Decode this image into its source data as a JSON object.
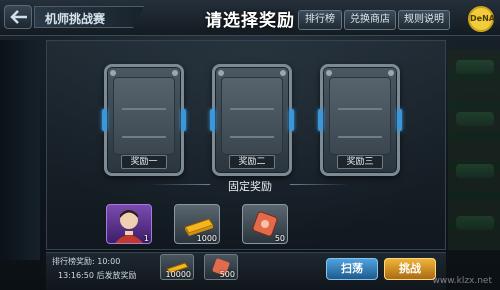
{
  "topbar": {
    "mode_title": "机师挑战赛",
    "title": "请选择奖励",
    "buttons": [
      "排行榜",
      "兑换商店",
      "规则说明"
    ],
    "logo_text": "DeNA"
  },
  "cards": [
    {
      "label": "奖励一"
    },
    {
      "label": "奖励二"
    },
    {
      "label": "奖励三"
    }
  ],
  "fixed_reward": {
    "title": "固定奖励",
    "items": [
      {
        "icon": "pilot-portrait-icon",
        "count": "1"
      },
      {
        "icon": "gold-bar-icon",
        "count": "1000"
      },
      {
        "icon": "ticket-icon",
        "count": "50"
      }
    ]
  },
  "bottom": {
    "rank_reward_label": "排行榜奖励: 10:00",
    "timer_text": "13:16:50 后发放奖励",
    "mini_items": [
      {
        "icon": "gold-bar-icon",
        "count": "10000"
      },
      {
        "icon": "ticket-icon",
        "count": "500"
      }
    ],
    "sweep_label": "扫荡",
    "fight_label": "挑战"
  },
  "watermark": "www.klzx.net",
  "colors": {
    "accent_blue": "#3b97d8",
    "fight_orange": "#f0b43a",
    "purple_item": "#7a4bb0"
  }
}
